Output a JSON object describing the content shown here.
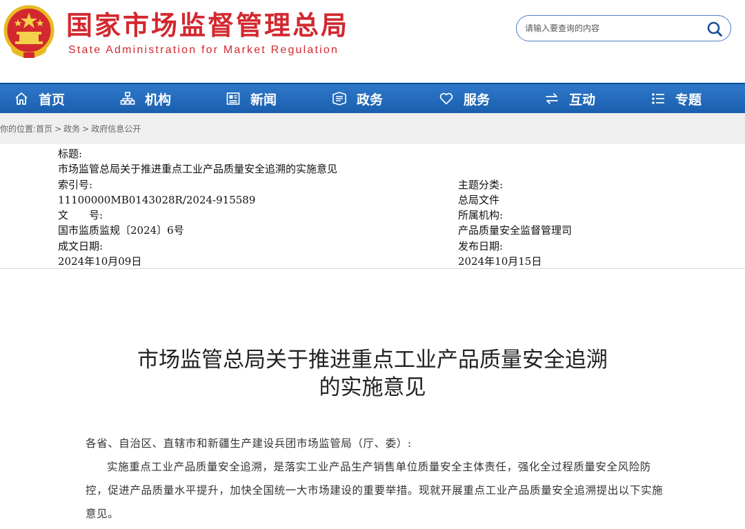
{
  "header": {
    "site_title_cn": "国家市场监督管理总局",
    "site_title_en": "State Administration for Market Regulation",
    "search_placeholder": "请输入要查询的内容",
    "brand_color": "#d3282f"
  },
  "nav": {
    "items": [
      {
        "label": "首页",
        "icon": "home-icon"
      },
      {
        "label": "机构",
        "icon": "org-chart-icon"
      },
      {
        "label": "新闻",
        "icon": "news-icon"
      },
      {
        "label": "政务",
        "icon": "affairs-icon"
      },
      {
        "label": "服务",
        "icon": "heart-icon"
      },
      {
        "label": "互动",
        "icon": "exchange-arrows-icon"
      },
      {
        "label": "专题",
        "icon": "topic-list-icon"
      }
    ],
    "color": "#2468b8"
  },
  "breadcrumb": {
    "prefix": "你的位置:",
    "items": [
      "首页",
      "政务",
      "政府信息公开"
    ],
    "separator": ">"
  },
  "info": {
    "title_label": "标题:",
    "title_value": "市场监管总局关于推进重点工业产品质量安全追溯的实施意见",
    "index_label": "索引号:",
    "index_value": "11100000MB0143028R/2024-915589",
    "topic_label": "主题分类:",
    "topic_value": "总局文件",
    "docno_label": "文　　号:",
    "docno_value": "国市监质监规〔2024〕6号",
    "org_label": "所属机构:",
    "org_value": "产品质量安全监督管理司",
    "written_label": "成文日期:",
    "written_value": "2024年10月09日",
    "published_label": "发布日期:",
    "published_value": "2024年10月15日"
  },
  "article": {
    "title_line1": "市场监管总局关于推进重点工业产品质量安全追溯",
    "title_line2": "的实施意见",
    "salutation": "各省、自治区、直辖市和新疆生产建设兵团市场监管局（厅、委）:",
    "paragraph1": "实施重点工业产品质量安全追溯，是落实工业产品生产销售单位质量安全主体责任，强化全过程质量安全风险防控，促进产品质量水平提升，加快全国统一大市场建设的重要举措。现就开展重点工业产品质量安全追溯提出以下实施意见。"
  }
}
